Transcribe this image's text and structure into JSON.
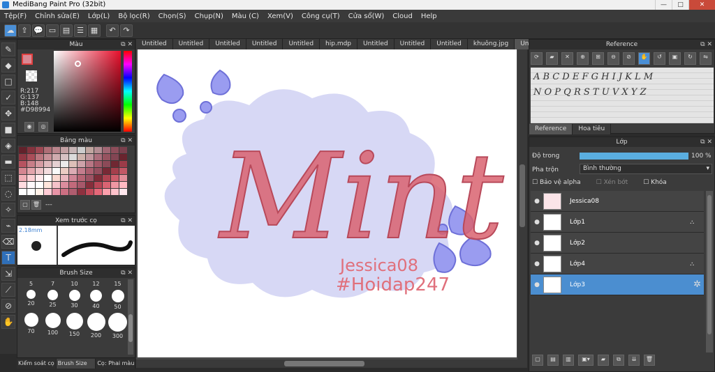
{
  "window": {
    "title": "MediBang Paint Pro (32bit)",
    "min": "—",
    "max": "□",
    "close": "✕"
  },
  "menu": [
    "Tệp(F)",
    "Chỉnh sửa(E)",
    "Lớp(L)",
    "Bộ lọc(R)",
    "Chọn(S)",
    "Chụp(N)",
    "Màu (C)",
    "Xem(V)",
    "Công cụ(T)",
    "Cửa sổ(W)",
    "Cloud",
    "Help"
  ],
  "tabs": [
    "Untitled",
    "Untitled",
    "Untitled",
    "Untitled",
    "Untitled",
    "hip.mdp",
    "Untitled",
    "Untitled",
    "Untitled",
    "khuông.jpg",
    "Untitled"
  ],
  "active_tab_index": 10,
  "color_panel": {
    "title": "Màu",
    "r": "R:217",
    "g": "G:137",
    "b": "B:148",
    "hex": "#D98994",
    "primary_color": "#D98994"
  },
  "palette_panel": {
    "title": "Bảng màu",
    "footer": "---"
  },
  "brush_preview": {
    "title": "Xem trước cọ",
    "size": "2.18mm"
  },
  "brush_size": {
    "title": "Brush Size",
    "header_sizes": [
      "5",
      "7",
      "10",
      "12",
      "15"
    ],
    "sizes": [
      "20",
      "25",
      "30",
      "40",
      "50",
      "70",
      "100",
      "150",
      "200",
      "300"
    ]
  },
  "left_bottom_tabs": [
    "Kiểm soát cọ",
    "Brush Size",
    "Cọ: Phai màu"
  ],
  "reference": {
    "title": "Reference",
    "tabs": [
      "Reference",
      "Hoa tiêu"
    ],
    "line1": "A B C D E F G H I J K L M",
    "line2": "N O P Q R S T U V X Y Z"
  },
  "layer_panel": {
    "title": "Lớp",
    "opacity_label": "Độ trong",
    "opacity_value": "100 %",
    "opacity_fraction": 1.0,
    "blend_label": "Pha trộn",
    "blend_value": "Bình thường",
    "alpha_lock": "Bảo vệ alpha",
    "clipping": "Xén bớt",
    "lock": "Khóa",
    "layers": [
      {
        "name": "Jessica08",
        "selected": false
      },
      {
        "name": "Lớp1",
        "selected": false
      },
      {
        "name": "Lớp2",
        "selected": false
      },
      {
        "name": "Lớp4",
        "selected": false
      },
      {
        "name": "Lớp3",
        "selected": true
      }
    ]
  },
  "artwork": {
    "title_text": "Mint",
    "signature": "Jessica08",
    "hashtag": "#Hoidap247",
    "cloud_color": "#D7D8F5",
    "drop_color": "#9A9CF0",
    "text_color": "#D96370"
  }
}
